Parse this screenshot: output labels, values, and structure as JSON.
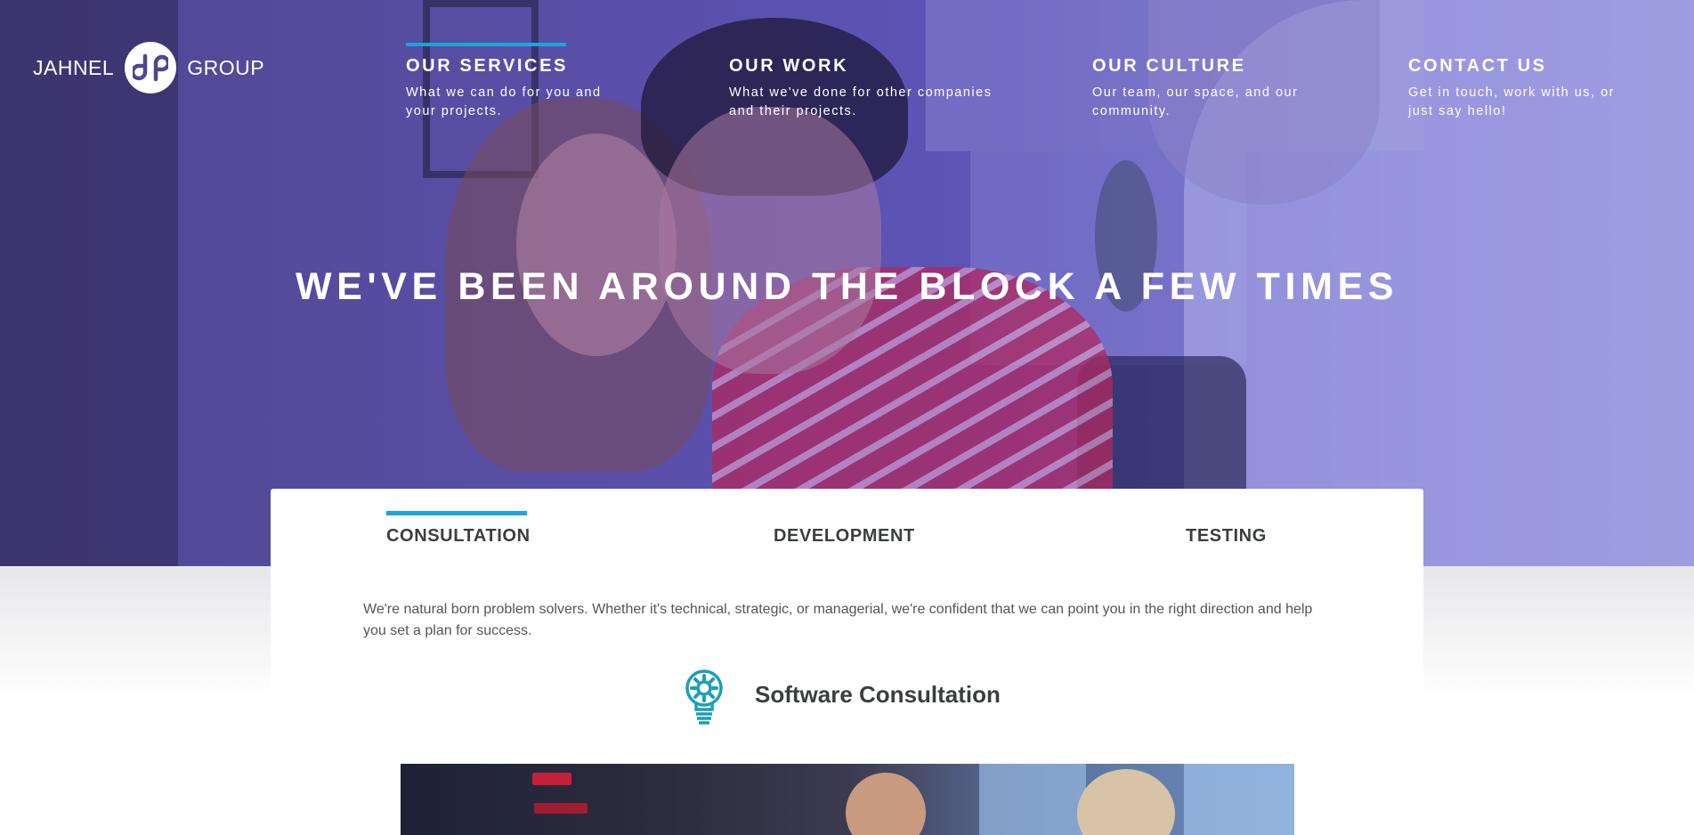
{
  "brand": {
    "word_left": "JAHNEL",
    "word_right": "GROUP",
    "accent": "#1aa6d8",
    "overlay": "#5a4fa8"
  },
  "nav": [
    {
      "title": "OUR SERVICES",
      "desc": "What we can do for you and your projects.",
      "active": true
    },
    {
      "title": "OUR WORK",
      "desc": "What we've done for other companies and their projects.",
      "active": false
    },
    {
      "title": "OUR CULTURE",
      "desc": "Our team, our space, and our community.",
      "active": false
    },
    {
      "title": "CONTACT US",
      "desc": "Get in touch, work with us, or just say hello!",
      "active": false
    }
  ],
  "hero": {
    "title": "WE'VE BEEN AROUND THE BLOCK A FEW TIMES"
  },
  "tabs": [
    {
      "label": "CONSULTATION",
      "active": true
    },
    {
      "label": "DEVELOPMENT",
      "active": false
    },
    {
      "label": "TESTING",
      "active": false
    }
  ],
  "content": {
    "intro": "We're natural born problem solvers. Whether it's technical, strategic, or managerial, we're confident that we can point you in the right direction and help you set a plan for success.",
    "service_title": "Software Consultation",
    "service_icon": "lightbulb-gear-icon"
  }
}
